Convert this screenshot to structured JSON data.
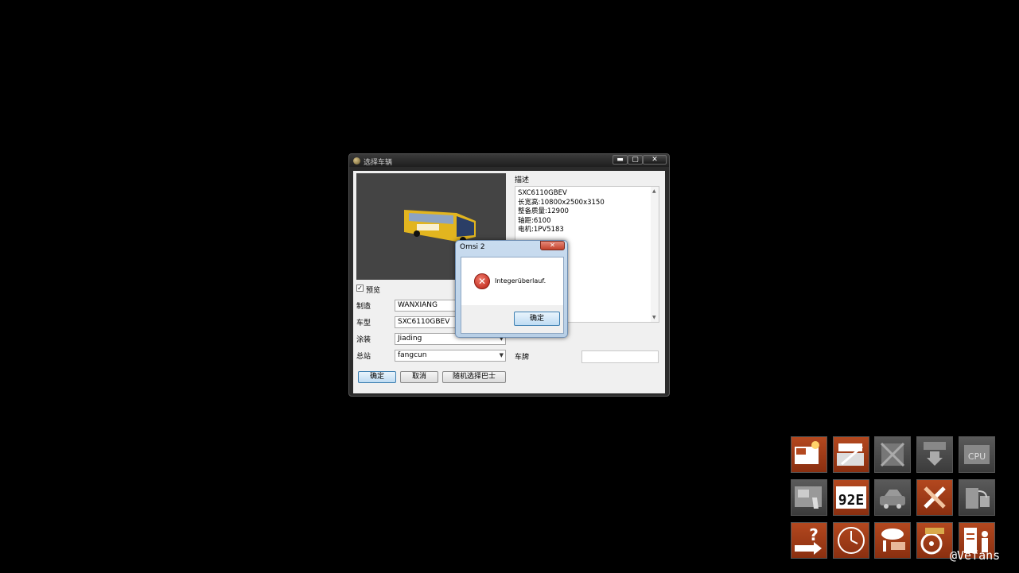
{
  "main_window": {
    "title": "选择车辆",
    "min_label": "▬",
    "max_label": "▢",
    "close_label": "✕",
    "preview_checkbox": {
      "label": "预览",
      "checked": true,
      "mark": "✓"
    },
    "fields": {
      "maker": {
        "label": "制造",
        "value": "WANXIANG"
      },
      "model": {
        "label": "车型",
        "value": "SXC6110GBEV"
      },
      "livery": {
        "label": "涂装",
        "value": "Jiading"
      },
      "depot": {
        "label": "总站",
        "value": "fangcun"
      },
      "plate": {
        "label": "车牌",
        "value": ""
      }
    },
    "description": {
      "label": "描述",
      "lines": [
        "SXC6110GBEV",
        "长宽高:10800x2500x3150",
        "整备质量:12900",
        "轴距:6100",
        "电机:1PV5183"
      ]
    },
    "buttons": {
      "ok": "确定",
      "cancel": "取消",
      "random": "随机选择巴士"
    }
  },
  "error_dialog": {
    "title": "Omsi 2",
    "close_label": "✕",
    "message": "Integerüberlauf.",
    "ok_label": "确定",
    "icon": "error-icon"
  },
  "tiles": [
    [
      "bus-light-icon",
      "bus-schedule-icon",
      "bus-disabled-icon",
      "bus-download-icon",
      "cpu-bus-icon"
    ],
    [
      "ticket-printer-icon",
      "route-number-icon",
      "traffic-car-icon",
      "tools-icon",
      "fuel-station-icon"
    ],
    [
      "help-arrow-icon",
      "clock-icon",
      "weather-icon",
      "steering-wheel-icon",
      "passenger-list-icon"
    ]
  ],
  "watermark": "@Vefans"
}
